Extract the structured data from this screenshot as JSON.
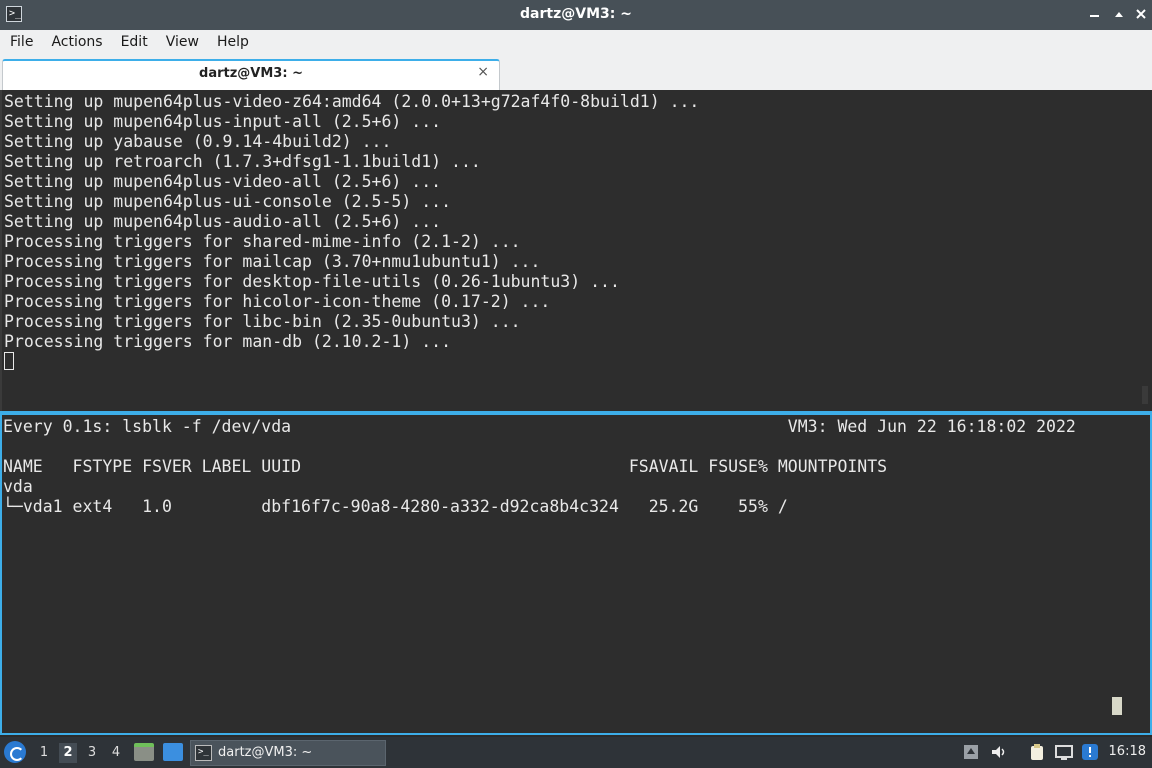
{
  "window": {
    "title": "dartz@VM3: ~",
    "icon": "terminal-icon",
    "controls": [
      "minimize",
      "maximize",
      "close"
    ]
  },
  "menubar": {
    "items": [
      "File",
      "Actions",
      "Edit",
      "View",
      "Help"
    ]
  },
  "tabs": [
    {
      "label": "dartz@VM3: ~",
      "close": "×"
    }
  ],
  "top_pane": {
    "lines": [
      "Setting up mupen64plus-video-z64:amd64 (2.0.0+13+g72af4f0-8build1) ...",
      "Setting up mupen64plus-input-all (2.5+6) ...",
      "Setting up yabause (0.9.14-4build2) ...",
      "Setting up retroarch (1.7.3+dfsg1-1.1build1) ...",
      "Setting up mupen64plus-video-all (2.5+6) ...",
      "Setting up mupen64plus-ui-console (2.5-5) ...",
      "Setting up mupen64plus-audio-all (2.5+6) ...",
      "Processing triggers for shared-mime-info (2.1-2) ...",
      "Processing triggers for mailcap (3.70+nmu1ubuntu1) ...",
      "Processing triggers for desktop-file-utils (0.26-1ubuntu3) ...",
      "Processing triggers for hicolor-icon-theme (0.17-2) ...",
      "Processing triggers for libc-bin (2.35-0ubuntu3) ...",
      "Processing triggers for man-db (2.10.2-1) ..."
    ]
  },
  "bottom_pane": {
    "lines": [
      "Every 0.1s: lsblk -f /dev/vda                                                  VM3: Wed Jun 22 16:18:02 2022",
      "",
      "NAME   FSTYPE FSVER LABEL UUID                                 FSAVAIL FSUSE% MOUNTPOINTS",
      "vda",
      "└─vda1 ext4   1.0         dbf16f7c-90a8-4280-a332-d92ca8b4c324   25.2G    55% /"
    ]
  },
  "taskbar": {
    "desktops": [
      "1",
      "2",
      "3",
      "4"
    ],
    "active_desktop": "2",
    "task_label": "dartz@VM3: ~",
    "clock": "16:18"
  },
  "colors": {
    "titlebar": "#475057",
    "accent": "#3daee9",
    "terminal_bg": "#2d2d2d",
    "terminal_fg": "#e8e8e8",
    "taskbar": "#2e3338"
  }
}
